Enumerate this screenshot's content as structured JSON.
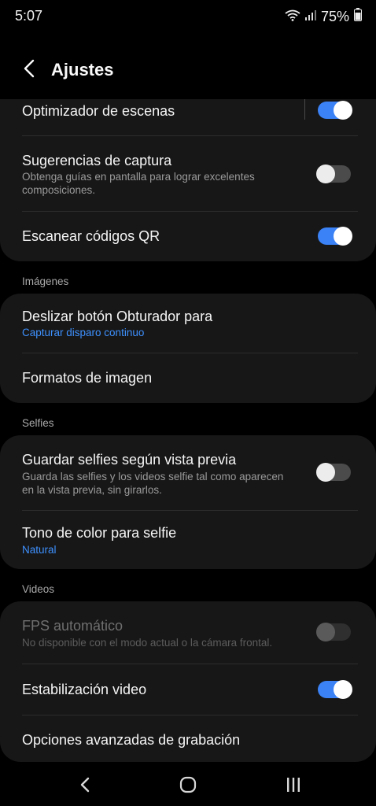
{
  "status_bar": {
    "time": "5:07",
    "battery": "75%"
  },
  "header": {
    "title": "Ajustes"
  },
  "group1": {
    "scene_optimizer": {
      "label": "Optimizador de escenas",
      "enabled": true
    },
    "shot_suggestions": {
      "label": "Sugerencias de captura",
      "description": "Obtenga guías en pantalla para lograr excelentes composiciones.",
      "enabled": false
    },
    "scan_qr": {
      "label": "Escanear códigos QR",
      "enabled": true
    }
  },
  "images": {
    "section_label": "Imágenes",
    "swipe_shutter": {
      "label": "Deslizar botón Obturador para",
      "value": "Capturar disparo continuo"
    },
    "image_formats": {
      "label": "Formatos de imagen"
    }
  },
  "selfies": {
    "section_label": "Selfies",
    "save_as_previewed": {
      "label": "Guardar selfies según vista previa",
      "description": "Guarda las selfies y los videos selfie tal como aparecen en la vista previa, sin girarlos.",
      "enabled": false
    },
    "selfie_color_tone": {
      "label": "Tono de color para selfie",
      "value": "Natural"
    }
  },
  "videos": {
    "section_label": "Videos",
    "auto_fps": {
      "label": "FPS automático",
      "description": "No disponible con el modo actual o la cámara frontal.",
      "enabled": false,
      "disabled": true
    },
    "video_stabilization": {
      "label": "Estabilización video",
      "enabled": true
    },
    "advanced_recording": {
      "label": "Opciones avanzadas de grabación"
    }
  },
  "colors": {
    "accent": "#3b82f6",
    "link": "#3e91ff",
    "card": "#171717",
    "background": "#000000"
  },
  "icons": [
    "wifi-icon",
    "signal-icon",
    "battery-icon",
    "back-icon",
    "nav-back-icon",
    "nav-home-icon",
    "nav-recents-icon"
  ]
}
